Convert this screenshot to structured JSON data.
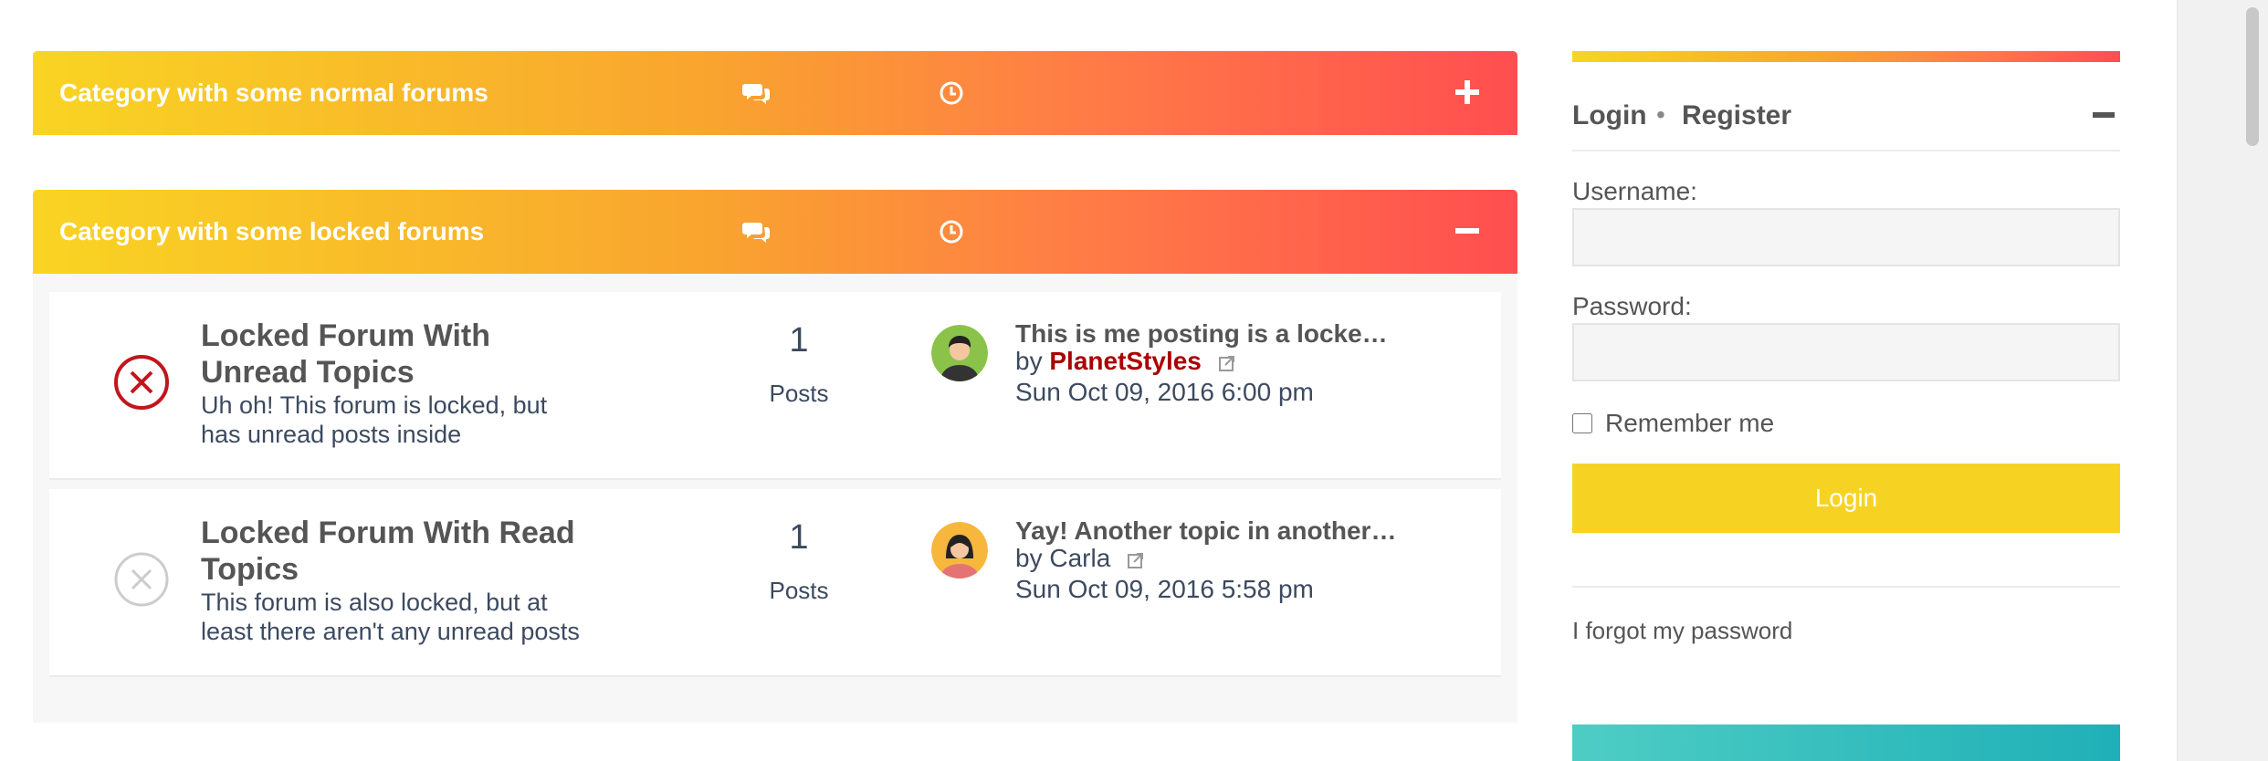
{
  "categories": [
    {
      "title": "Category with some normal forums",
      "topics_icon": "comments-icon",
      "lastpost_icon": "clock-icon",
      "toggle": "plus-icon",
      "forums": []
    },
    {
      "title": "Category with some locked forums",
      "topics_icon": "comments-icon",
      "lastpost_icon": "clock-icon",
      "toggle": "minus-icon",
      "forums": [
        {
          "title": "Locked Forum With Unread Topics",
          "description": "Uh oh! This forum is locked, but has unread posts inside",
          "status_icon": "locked-unread-icon",
          "posts_count": "1",
          "posts_label": "Posts",
          "last_post": {
            "title": "This is me posting is a locke…",
            "by": "by",
            "author": "PlanetStyles",
            "date": "Sun Oct 09, 2016 6:00 pm",
            "avatar": "male-avatar"
          }
        },
        {
          "title": "Locked Forum With Read Topics",
          "description": "This forum is also locked, but at least there aren't any unread posts",
          "status_icon": "locked-read-icon",
          "posts_count": "1",
          "posts_label": "Posts",
          "last_post": {
            "title": "Yay! Another topic in another…",
            "by": "by",
            "author": "Carla",
            "date": "Sun Oct 09, 2016 5:58 pm",
            "avatar": "female-avatar"
          }
        }
      ]
    }
  ],
  "login_panel": {
    "login_link": "Login",
    "separator": "•",
    "register_link": "Register",
    "username_label": "Username:",
    "username_value": "",
    "password_label": "Password:",
    "password_value": "",
    "remember_label": "Remember me",
    "remember_checked": false,
    "login_button": "Login",
    "forgot_link": "I forgot my password"
  },
  "colors": {
    "gradient_start": "#f9d423",
    "gradient_end": "#ff4e50",
    "login_button": "#f6d323",
    "unread_locked": "#c0161c",
    "read_locked": "#cccccc",
    "author_highlight": "#aa0000"
  }
}
